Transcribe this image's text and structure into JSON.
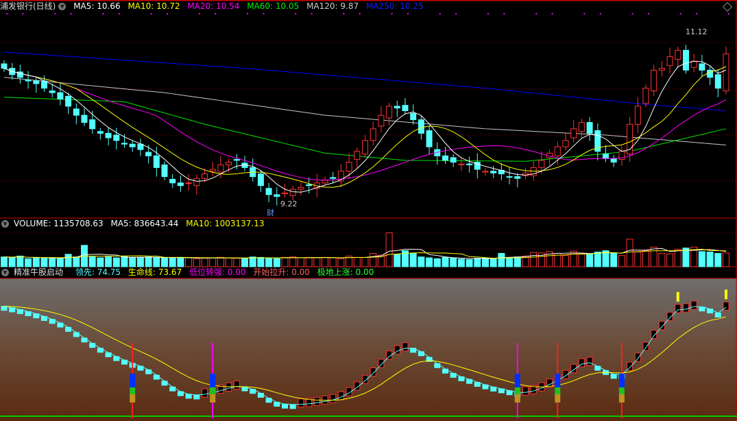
{
  "main": {
    "title": "浦发银行(日线)",
    "ma5": "MA5: 10.66",
    "ma10": "MA10: 10.72",
    "ma20": "MA20: 10.54",
    "ma60": "MA60: 10.05",
    "ma120": "MA120: 9.87",
    "ma250": "MA250: 10.25",
    "high_label": "11.12",
    "low_label": "9.22",
    "event_marker": "财"
  },
  "volume": {
    "label": "VOLUME: 1135708.63",
    "ma5": "MA5: 836643.44",
    "ma10": "MA10: 1003137.13"
  },
  "indicator": {
    "title": "精准牛股启动",
    "lead": "领先: 74.75",
    "life": "生命线: 73.67",
    "low_strong": "低位转强: 0.00",
    "start_rise": "开始拉升: 0.00",
    "bottom_rise": "极地上涨: 0.00"
  },
  "colors": {
    "up": "#ff3232",
    "down": "#54ffff",
    "ma5": "#ffffff",
    "ma10": "#ffff00",
    "ma20": "#ff00ff",
    "ma60": "#00e600",
    "ma120": "#c8c8c8",
    "ma250": "#0000ff"
  },
  "chart_data": {
    "type": "candlestick",
    "price_range": [
      9.0,
      11.3
    ],
    "close": [
      10.72,
      10.65,
      10.62,
      10.58,
      10.55,
      10.5,
      10.45,
      10.38,
      10.3,
      10.2,
      10.12,
      10.05,
      10.0,
      9.95,
      9.92,
      9.88,
      9.85,
      9.82,
      9.75,
      9.62,
      9.52,
      9.45,
      9.42,
      9.45,
      9.5,
      9.55,
      9.6,
      9.65,
      9.68,
      9.7,
      9.62,
      9.52,
      9.42,
      9.32,
      9.3,
      9.34,
      9.38,
      9.4,
      9.42,
      9.45,
      9.48,
      9.5,
      9.58,
      9.68,
      9.8,
      9.92,
      10.05,
      10.2,
      10.3,
      10.28,
      10.25,
      10.15,
      10.0,
      9.85,
      9.75,
      9.7,
      9.68,
      9.66,
      9.65,
      9.6,
      9.58,
      9.56,
      9.55,
      9.52,
      9.5,
      9.56,
      9.62,
      9.7,
      9.78,
      9.85,
      9.92,
      10.05,
      10.12,
      10.0,
      9.8,
      9.72,
      9.68,
      9.8,
      10.1,
      10.3,
      10.5,
      10.7,
      10.72,
      10.85,
      10.92,
      10.7,
      10.8,
      10.7,
      10.62,
      10.5,
      10.88
    ],
    "volume_k": [
      1100,
      1050,
      1200,
      900,
      1000,
      950,
      1000,
      900,
      1400,
      1100,
      2400,
      1100,
      1000,
      1100,
      1000,
      1150,
      1050,
      1050,
      1100,
      1000,
      1000,
      1000,
      1050,
      1000,
      900,
      950,
      1000,
      1050,
      1000,
      950,
      900,
      1100,
      1050,
      1000,
      900,
      1050,
      1100,
      1000,
      1050,
      1000,
      1050,
      1000,
      900,
      1200,
      1050,
      1050,
      1500,
      1300,
      3800,
      1400,
      1800,
      1500,
      1100,
      1000,
      900,
      1050,
      1000,
      850,
      800,
      950,
      1000,
      900,
      1500,
      950,
      1100,
      1200,
      1600,
      1550,
      1700,
      1500,
      1250,
      1750,
      1500,
      1400,
      1650,
      1800,
      1500,
      1250,
      3100,
      1650,
      1800,
      2200,
      1500,
      1450,
      1950,
      2100,
      2200,
      1700,
      1650,
      1500,
      1550
    ],
    "ma120": [
      [
        0,
        10.62
      ],
      [
        20,
        10.45
      ],
      [
        40,
        10.2
      ],
      [
        60,
        10.05
      ],
      [
        75,
        9.98
      ],
      [
        90,
        9.87
      ]
    ],
    "ma250": [
      [
        0,
        10.9
      ],
      [
        30,
        10.72
      ],
      [
        60,
        10.5
      ],
      [
        80,
        10.32
      ],
      [
        90,
        10.25
      ]
    ],
    "ma60": [
      [
        0,
        10.4
      ],
      [
        15,
        10.35
      ],
      [
        25,
        10.1
      ],
      [
        40,
        9.78
      ],
      [
        50,
        9.7
      ],
      [
        65,
        9.69
      ],
      [
        78,
        9.8
      ],
      [
        90,
        10.05
      ]
    ],
    "signals": [
      {
        "i": 16,
        "type": "red"
      },
      {
        "i": 26,
        "type": "magenta"
      },
      {
        "i": 64,
        "type": "magenta"
      },
      {
        "i": 69,
        "type": "red"
      },
      {
        "i": 77,
        "type": "red"
      }
    ]
  }
}
